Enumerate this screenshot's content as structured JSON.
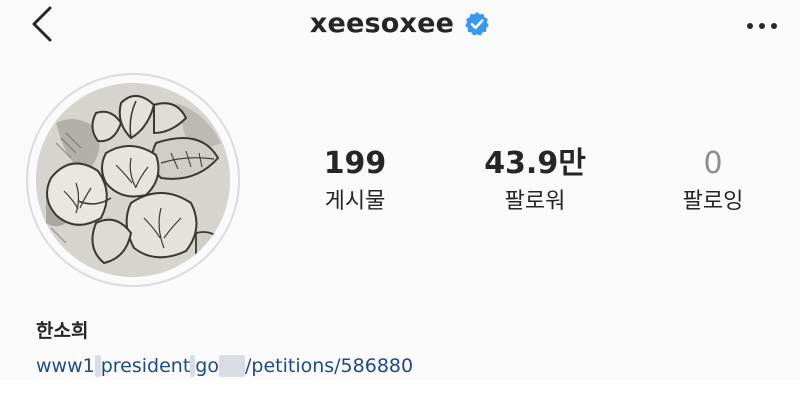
{
  "header": {
    "username": "xeesoxee",
    "verified": true,
    "badge_color": "#3897f0",
    "back_icon": "chevron-left-icon",
    "more_icon": "ellipsis-icon"
  },
  "profile": {
    "avatar_description_icon": "hibiscus-drawing-avatar"
  },
  "stats": {
    "posts": {
      "value": "199",
      "label": "게시물"
    },
    "followers": {
      "value": "43.9만",
      "label": "팔로워"
    },
    "following": {
      "value": "0",
      "label": "팔로잉"
    }
  },
  "bio": {
    "full_name": "한소희",
    "link": {
      "part1": "www1",
      "part2": "president",
      "part3": "go",
      "part4": "/petitions/586880"
    },
    "link_color": "#1d4b86"
  }
}
